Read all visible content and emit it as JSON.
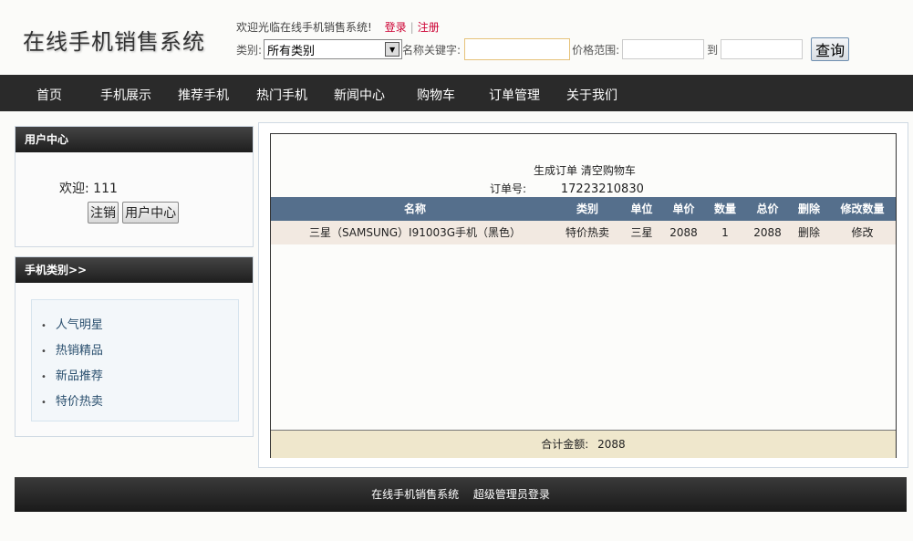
{
  "header": {
    "logo": "在线手机销售系统",
    "welcome": "欢迎光临在线手机销售系统!",
    "login": "登录",
    "register": "注册",
    "category_label": "类别:",
    "category_value": "所有类别",
    "keyword_label": "名称关键字:",
    "price_label": "价格范围:",
    "to_label": "到",
    "search_button": "查询"
  },
  "nav": [
    "首页",
    "手机展示",
    "推荐手机",
    "热门手机",
    "新闻中心",
    "购物车",
    "订单管理",
    "关于我们"
  ],
  "user_center": {
    "title": "用户中心",
    "welcome": "欢迎:",
    "username": "111",
    "logout": "注销",
    "center": "用户中心"
  },
  "categories": {
    "title": "手机类别>>",
    "items": [
      "人气明星",
      "热销精品",
      "新品推荐",
      "特价热卖"
    ]
  },
  "cart": {
    "gen_order": "生成订单",
    "clear_cart": "清空购物车",
    "order_label": "订单号:",
    "order_no": "17223210830",
    "columns": [
      "名称",
      "类别",
      "单位",
      "单价",
      "数量",
      "总价",
      "删除",
      "修改数量"
    ],
    "rows": [
      [
        "三星（SAMSUNG）I91003G手机（黑色）",
        "特价热卖",
        "三星",
        "2088",
        "1",
        "2088",
        "删除",
        "修改"
      ]
    ],
    "total_label": "合计金额:",
    "total_value": "2088"
  },
  "footer": {
    "site": "在线手机销售系统",
    "admin": "超级管理员登录"
  }
}
